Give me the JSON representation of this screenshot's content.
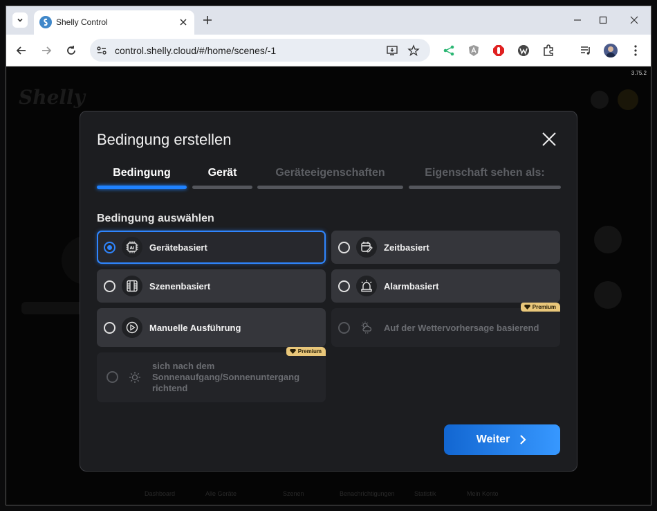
{
  "browser": {
    "tab_title": "Shelly Control",
    "url": "control.shelly.cloud/#/home/scenes/-1"
  },
  "app": {
    "version": "3.75.2",
    "background": {
      "logo": "Shelly",
      "bottom_nav": [
        "Dashboard",
        "Alle Geräte",
        "Szenen",
        "Benachrichtigungen",
        "Statistik",
        "Mein Konto"
      ]
    }
  },
  "modal": {
    "title": "Bedingung erstellen",
    "steps": [
      {
        "label": "Bedingung"
      },
      {
        "label": "Gerät"
      },
      {
        "label": "Geräteeigenschaften"
      },
      {
        "label": "Eigenschaft sehen als:"
      }
    ],
    "section_title": "Bedingung auswählen",
    "options": [
      {
        "label": "Gerätebasiert",
        "icon": "ai-chip-icon",
        "selected": true
      },
      {
        "label": "Zeitbasiert",
        "icon": "calendar-edit-icon"
      },
      {
        "label": "Szenenbasiert",
        "icon": "film-icon"
      },
      {
        "label": "Alarmbasiert",
        "icon": "siren-icon"
      },
      {
        "label": "Manuelle Ausführung",
        "icon": "play-circle-icon"
      },
      {
        "label": "Auf der Wettervorhersage basierend",
        "icon": "weather-icon",
        "disabled": true,
        "badge": "Premium"
      },
      {
        "label": "sich nach dem Sonnenaufgang/Sonnenuntergang richtend",
        "icon": "sun-gear-icon",
        "disabled": true,
        "badge": "Premium"
      }
    ],
    "next_button": "Weiter"
  },
  "colors": {
    "accent": "#1f82ff",
    "premium": "#e9c77a",
    "modal_bg": "#1c1d20"
  }
}
